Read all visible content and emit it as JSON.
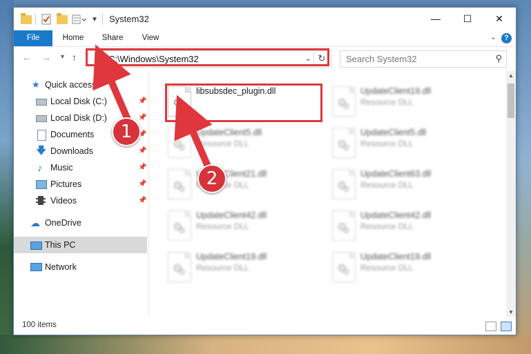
{
  "window": {
    "title": "System32"
  },
  "ribbon": {
    "tabs": [
      "File",
      "Home",
      "Share",
      "View"
    ],
    "help_label": "?"
  },
  "address": {
    "path": "C:\\Windows\\System32"
  },
  "search": {
    "placeholder": "Search System32"
  },
  "sidebar": {
    "items": [
      {
        "label": "Quick access",
        "icon": "star-icon",
        "pinned": false
      },
      {
        "label": "Local Disk (C:)",
        "icon": "drive-icon",
        "pinned": true
      },
      {
        "label": "Local Disk (D:)",
        "icon": "drive-icon",
        "pinned": true
      },
      {
        "label": "Documents",
        "icon": "documents-icon",
        "pinned": true
      },
      {
        "label": "Downloads",
        "icon": "download-icon",
        "pinned": true
      },
      {
        "label": "Music",
        "icon": "music-icon",
        "pinned": true
      },
      {
        "label": "Pictures",
        "icon": "pictures-icon",
        "pinned": true
      },
      {
        "label": "Videos",
        "icon": "videos-icon",
        "pinned": true
      },
      {
        "label": "OneDrive",
        "icon": "cloud-icon",
        "pinned": false
      },
      {
        "label": "This PC",
        "icon": "computer-icon",
        "pinned": false,
        "selected": true
      },
      {
        "label": "Network",
        "icon": "network-icon",
        "pinned": false
      }
    ]
  },
  "files": [
    {
      "name": "libsubsdec_plugin.dll",
      "type": "",
      "blurred": false
    },
    {
      "name": "UpdateClient19.dll",
      "type": "Resource DLL",
      "blurred": true
    },
    {
      "name": "UpdateClient5.dll",
      "type": "Resource DLL",
      "blurred": true
    },
    {
      "name": "UpdateClient5.dll",
      "type": "Resource DLL",
      "blurred": true
    },
    {
      "name": "UpdateClient21.dll",
      "type": "Resource DLL",
      "blurred": true
    },
    {
      "name": "UpdateClient63.dll",
      "type": "Resource DLL",
      "blurred": true
    },
    {
      "name": "UpdateClient42.dll",
      "type": "Resource DLL",
      "blurred": true
    },
    {
      "name": "UpdateClient42.dll",
      "type": "Resource DLL",
      "blurred": true
    },
    {
      "name": "UpdateClient19.dll",
      "type": "Resource DLL",
      "blurred": true
    },
    {
      "name": "UpdateClient19.dll",
      "type": "Resource DLL",
      "blurred": true
    }
  ],
  "status": {
    "item_count": "100 items"
  },
  "annotations": {
    "step1": "1",
    "step2": "2",
    "color": "#e0363d"
  }
}
